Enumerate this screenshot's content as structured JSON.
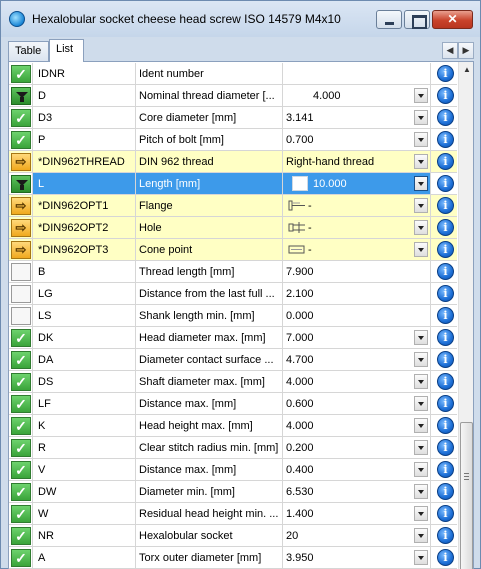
{
  "window": {
    "title": "Hexalobular socket cheese head screw ISO 14579 M4x10",
    "icon": "globe-icon"
  },
  "tabs": [
    {
      "label": "Table",
      "active": false
    },
    {
      "label": "List",
      "active": true
    }
  ],
  "tab_nav": {
    "prev": "◀",
    "next": "▶"
  },
  "scrollbar": {
    "up_arrow": "▲"
  },
  "colors": {
    "highlight_row": "#ffffc4",
    "selected_row": "#3d9aea",
    "status_check": "#3aa43a",
    "status_arrow": "#f0a81e"
  },
  "rows": [
    {
      "status": "check",
      "id": "IDNR",
      "desc": "Ident number",
      "value": "",
      "dropdown": false
    },
    {
      "status": "filter",
      "id": "D",
      "desc": "Nominal thread diameter [...",
      "value": "4.000",
      "dropdown": true,
      "centered": true
    },
    {
      "status": "check",
      "id": "D3",
      "desc": "Core diameter [mm]",
      "value": "3.141",
      "dropdown": true
    },
    {
      "status": "check",
      "id": "P",
      "desc": "Pitch of bolt [mm]",
      "value": "0.700",
      "dropdown": true
    },
    {
      "status": "arrow",
      "id": "*DIN962THREAD",
      "desc": "DIN 962 thread",
      "value": "Right-hand thread",
      "dropdown": true,
      "highlight": true
    },
    {
      "status": "filter",
      "id": "L",
      "desc": "Length [mm]",
      "value": "10.000",
      "dropdown": true,
      "selected": true,
      "centered": true
    },
    {
      "status": "arrow",
      "id": "*DIN962OPT1",
      "desc": "Flange",
      "value": "-",
      "dropdown": true,
      "highlight": true,
      "image": "flange-icon"
    },
    {
      "status": "arrow",
      "id": "*DIN962OPT2",
      "desc": "Hole",
      "value": "-",
      "dropdown": true,
      "highlight": true,
      "image": "hole-icon"
    },
    {
      "status": "arrow",
      "id": "*DIN962OPT3",
      "desc": "Cone point",
      "value": "-",
      "dropdown": true,
      "highlight": true,
      "image": "cone-point-icon"
    },
    {
      "status": "empty",
      "id": "B",
      "desc": "Thread length [mm]",
      "value": "7.900",
      "dropdown": false
    },
    {
      "status": "empty",
      "id": "LG",
      "desc": "Distance from the last full ...",
      "value": "2.100",
      "dropdown": false
    },
    {
      "status": "empty",
      "id": "LS",
      "desc": "Shank length min. [mm]",
      "value": "0.000",
      "dropdown": false
    },
    {
      "status": "check",
      "id": "DK",
      "desc": "Head diameter max. [mm]",
      "value": "7.000",
      "dropdown": true
    },
    {
      "status": "check",
      "id": "DA",
      "desc": "Diameter contact surface ...",
      "value": "4.700",
      "dropdown": true
    },
    {
      "status": "check",
      "id": "DS",
      "desc": "Shaft diameter max. [mm]",
      "value": "4.000",
      "dropdown": true
    },
    {
      "status": "check",
      "id": "LF",
      "desc": "Distance max. [mm]",
      "value": "0.600",
      "dropdown": true
    },
    {
      "status": "check",
      "id": "K",
      "desc": "Head height max. [mm]",
      "value": "4.000",
      "dropdown": true
    },
    {
      "status": "check",
      "id": "R",
      "desc": "Clear stitch radius min. [mm]",
      "value": "0.200",
      "dropdown": true
    },
    {
      "status": "check",
      "id": "V",
      "desc": "Distance max. [mm]",
      "value": "0.400",
      "dropdown": true
    },
    {
      "status": "check",
      "id": "DW",
      "desc": "Diameter min. [mm]",
      "value": "6.530",
      "dropdown": true
    },
    {
      "status": "check",
      "id": "W",
      "desc": "Residual head height min. ...",
      "value": "1.400",
      "dropdown": true
    },
    {
      "status": "check",
      "id": "NR",
      "desc": "Hexalobular socket",
      "value": "20",
      "dropdown": true
    },
    {
      "status": "check",
      "id": "A",
      "desc": "Torx outer diameter [mm]",
      "value": "3.950",
      "dropdown": true
    }
  ],
  "info_glyph": "i"
}
